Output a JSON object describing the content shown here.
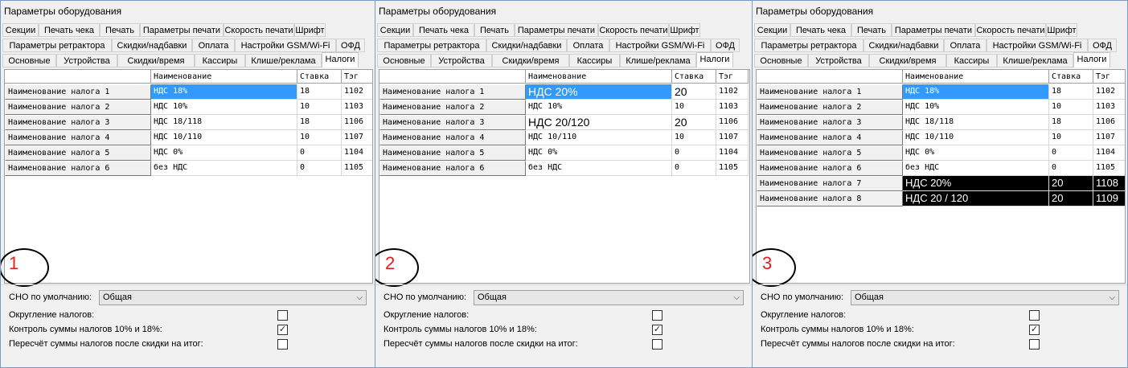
{
  "panels": [
    {
      "title": "Параметры оборудования",
      "tabs_row1": [
        "Секции",
        "Печать чека",
        "Печать",
        "Параметры печати",
        "Скорость печати",
        "Шрифт"
      ],
      "tabs_row2": [
        "Параметры ретрактора",
        "Скидки/надбавки",
        "Оплата",
        "Настройки GSM/Wi-Fi",
        "ОФД"
      ],
      "tabs_row3": [
        "Основные",
        "Устройства",
        "Скидки/время",
        "Кассиры",
        "Клише/реклама",
        "Налоги"
      ],
      "active_tab": "Налоги",
      "columns": [
        "Наименование",
        "Ставка",
        "Тэг"
      ],
      "rows": [
        {
          "header": "Наименование налога 1",
          "name": "НДС 18%",
          "rate": "18",
          "tag": "1102"
        },
        {
          "header": "Наименование налога 2",
          "name": "НДС 10%",
          "rate": "10",
          "tag": "1103"
        },
        {
          "header": "Наименование налога 3",
          "name": "НДС 18/118",
          "rate": "18",
          "tag": "1106"
        },
        {
          "header": "Наименование налога 4",
          "name": "НДС 10/110",
          "rate": "10",
          "tag": "1107"
        },
        {
          "header": "Наименование налога 5",
          "name": "НДС 0%",
          "rate": "0",
          "tag": "1104"
        },
        {
          "header": "Наименование налога 6",
          "name": "без НДС",
          "rate": "0",
          "tag": "1105"
        }
      ],
      "badge": "1",
      "sno_label": "СНО по умолчанию:",
      "sno_value": "Общая",
      "opt1": "Округление налогов:",
      "opt2": "Контроль суммы налогов 10% и 18%:",
      "opt3": "Пересчёт суммы налогов после скидки на итог:",
      "opt1_checked": false,
      "opt2_checked": true,
      "opt3_checked": false
    },
    {
      "title": "Параметры оборудования",
      "tabs_row1": [
        "Секции",
        "Печать чека",
        "Печать",
        "Параметры печати",
        "Скорость печати",
        "Шрифт"
      ],
      "tabs_row2": [
        "Параметры ретрактора",
        "Скидки/надбавки",
        "Оплата",
        "Настройки GSM/Wi-Fi",
        "ОФД"
      ],
      "tabs_row3": [
        "Основные",
        "Устройства",
        "Скидки/время",
        "Кассиры",
        "Клише/реклама",
        "Налоги"
      ],
      "active_tab": "Налоги",
      "columns": [
        "Наименование",
        "Ставка",
        "Тэг"
      ],
      "rows": [
        {
          "header": "Наименование налога 1",
          "name": "НДС 20%",
          "rate": "20",
          "tag": "1102"
        },
        {
          "header": "Наименование налога 2",
          "name": "НДС 10%",
          "rate": "10",
          "tag": "1103"
        },
        {
          "header": "Наименование налога 3",
          "name": "НДС 20/120",
          "rate": "20",
          "tag": "1106"
        },
        {
          "header": "Наименование налога 4",
          "name": "НДС 10/110",
          "rate": "10",
          "tag": "1107"
        },
        {
          "header": "Наименование налога 5",
          "name": "НДС 0%",
          "rate": "0",
          "tag": "1104"
        },
        {
          "header": "Наименование налога 6",
          "name": "без НДС",
          "rate": "0",
          "tag": "1105"
        }
      ],
      "badge": "2",
      "sno_label": "СНО по умолчанию:",
      "sno_value": "Общая",
      "opt1": "Округление налогов:",
      "opt2": "Контроль суммы налогов 10% и 18%:",
      "opt3": "Пересчёт суммы налогов после скидки на итог:",
      "opt1_checked": false,
      "opt2_checked": true,
      "opt3_checked": false
    },
    {
      "title": "Параметры оборудования",
      "tabs_row1": [
        "Секции",
        "Печать чека",
        "Печать",
        "Параметры печати",
        "Скорость печати",
        "Шрифт"
      ],
      "tabs_row2": [
        "Параметры ретрактора",
        "Скидки/надбавки",
        "Оплата",
        "Настройки GSM/Wi-Fi",
        "ОФД"
      ],
      "tabs_row3": [
        "Основные",
        "Устройства",
        "Скидки/время",
        "Кассиры",
        "Клише/реклама",
        "Налоги"
      ],
      "active_tab": "Налоги",
      "columns": [
        "Наименование",
        "Ставка",
        "Тэг"
      ],
      "rows": [
        {
          "header": "Наименование налога 1",
          "name": "НДС 18%",
          "rate": "18",
          "tag": "1102"
        },
        {
          "header": "Наименование налога 2",
          "name": "НДС 10%",
          "rate": "10",
          "tag": "1103"
        },
        {
          "header": "Наименование налога 3",
          "name": "НДС 18/118",
          "rate": "18",
          "tag": "1106"
        },
        {
          "header": "Наименование налога 4",
          "name": "НДС 10/110",
          "rate": "10",
          "tag": "1107"
        },
        {
          "header": "Наименование налога 5",
          "name": "НДС 0%",
          "rate": "0",
          "tag": "1104"
        },
        {
          "header": "Наименование налога 6",
          "name": "без НДС",
          "rate": "0",
          "tag": "1105"
        },
        {
          "header": "Наименование налога 7",
          "name": "НДС 20%",
          "rate": "20",
          "tag": "1108"
        },
        {
          "header": "Наименование налога 8",
          "name": "НДС 20 / 120",
          "rate": "20",
          "tag": "1109"
        }
      ],
      "badge": "3",
      "sno_label": "СНО по умолчанию:",
      "sno_value": "Общая",
      "opt1": "Округление налогов:",
      "opt2": "Контроль суммы налогов 10% и 18%:",
      "opt3": "Пересчёт суммы налогов после скидки на итог:",
      "opt1_checked": false,
      "opt2_checked": true,
      "opt3_checked": false
    }
  ]
}
